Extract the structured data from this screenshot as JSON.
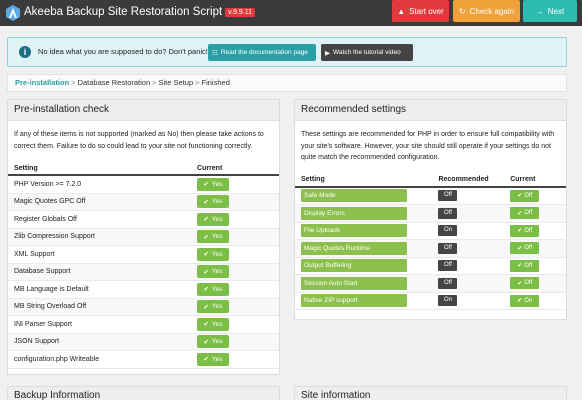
{
  "header": {
    "title": "Akeeba Backup Site Restoration Script",
    "version": "v.9.9.11",
    "buttons": {
      "start_over": "Start over",
      "check_again": "Check again",
      "next": "Next"
    }
  },
  "info": {
    "text": "No idea what you are supposed to do? Don't panic!",
    "doc_button": "Read the documentation page",
    "video_button": "Watch the tutorial video"
  },
  "breadcrumb": [
    "Pre-installation",
    "Database Restoration",
    "Site Setup",
    "Finished"
  ],
  "preinstall": {
    "title": "Pre-installation check",
    "description": "If any of these items is not supported (marked as No) then please take actions to correct them. Failure to do so could lead to your site not functioning correctly.",
    "columns": [
      "Setting",
      "Current"
    ],
    "rows": [
      {
        "setting": "PHP Version >= 7.2.0",
        "current": "Yes"
      },
      {
        "setting": "Magic Quotes GPC Off",
        "current": "Yes"
      },
      {
        "setting": "Register Globals Off",
        "current": "Yes"
      },
      {
        "setting": "Zlib Compression Support",
        "current": "Yes"
      },
      {
        "setting": "XML Support",
        "current": "Yes"
      },
      {
        "setting": "Database Support",
        "current": "Yes"
      },
      {
        "setting": "MB Language is Default",
        "current": "Yes"
      },
      {
        "setting": "MB String Overload Off",
        "current": "Yes"
      },
      {
        "setting": "INI Parser Support",
        "current": "Yes"
      },
      {
        "setting": "JSON Support",
        "current": "Yes"
      },
      {
        "setting": "configuration.php Writeable",
        "current": "Yes"
      }
    ]
  },
  "recommended": {
    "title": "Recommended settings",
    "description": "These settings are recommended for PHP in order to ensure full compatibility with your site's software. However, your site should still operate if your settings do not quite match the recommended configuration.",
    "columns": [
      "Setting",
      "Recommended",
      "Current"
    ],
    "rows": [
      {
        "setting": "Safe Mode",
        "recommended": "Off",
        "current": "Off"
      },
      {
        "setting": "Display Errors",
        "recommended": "Off",
        "current": "Off"
      },
      {
        "setting": "File Uploads",
        "recommended": "On",
        "current": "Off"
      },
      {
        "setting": "Magic Quotes Runtime",
        "recommended": "Off",
        "current": "Off"
      },
      {
        "setting": "Output Buffering",
        "recommended": "Off",
        "current": "Off"
      },
      {
        "setting": "Session Auto Start",
        "recommended": "Off",
        "current": "Off"
      },
      {
        "setting": "Native ZIP support",
        "recommended": "On",
        "current": "On"
      }
    ]
  },
  "bottom_panels": {
    "backup": "Backup Information",
    "site": "Site information"
  }
}
